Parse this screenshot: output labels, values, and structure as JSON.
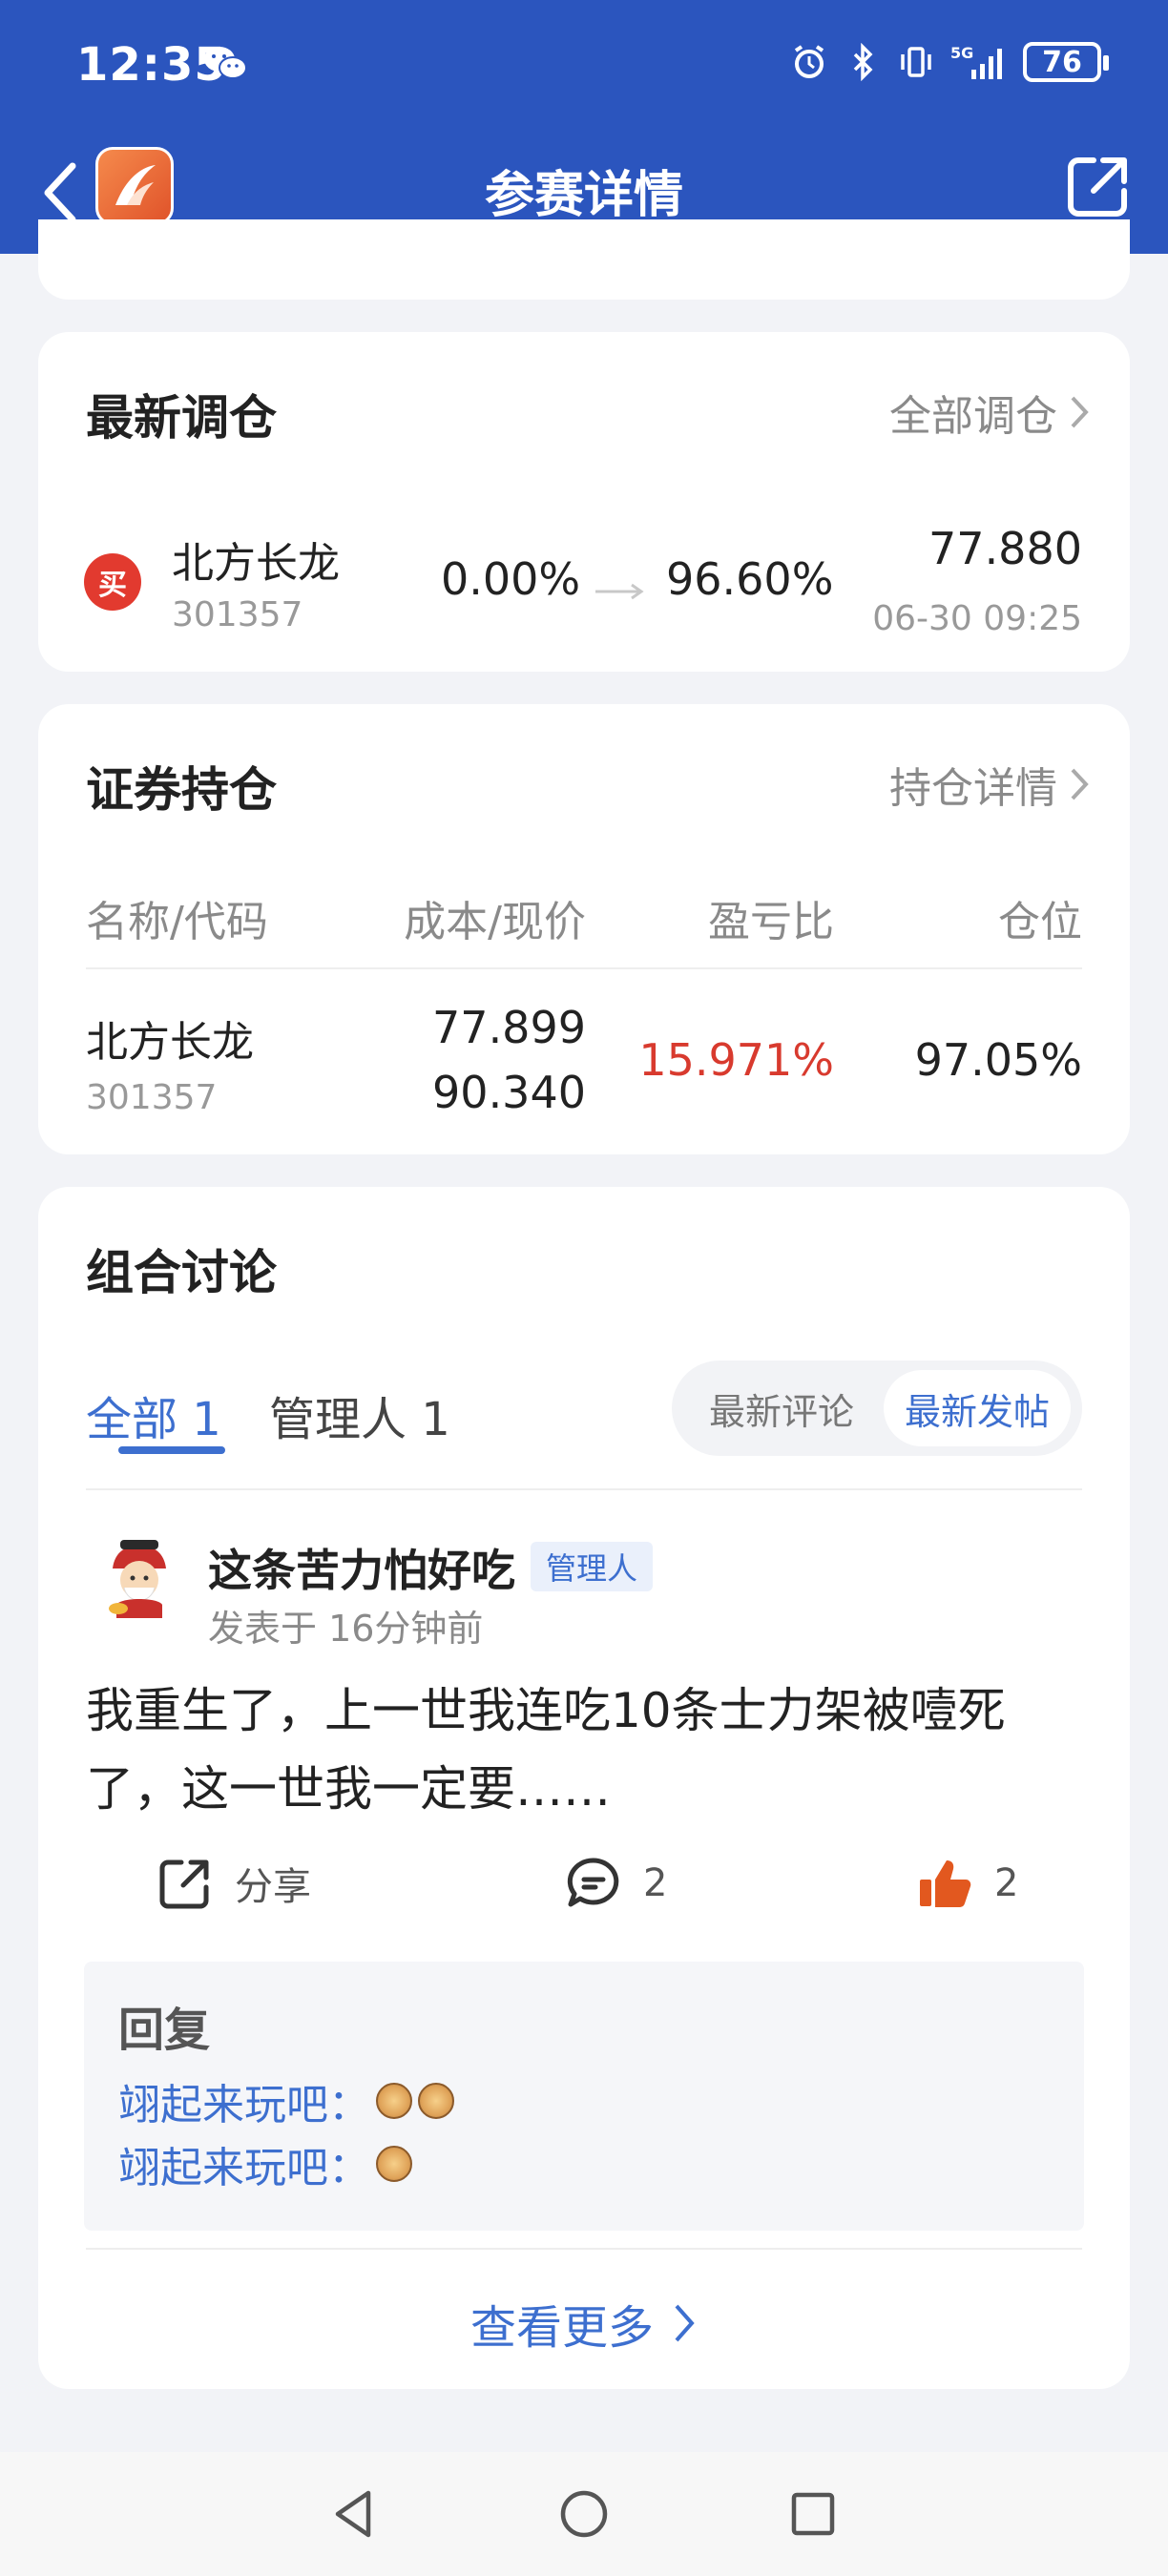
{
  "status_bar": {
    "time": "12:35",
    "battery": "76"
  },
  "nav": {
    "title": "参赛详情"
  },
  "latest_adjust": {
    "title": "最新调仓",
    "link": "全部调仓",
    "badge": "买",
    "stock_name": "北方长龙",
    "stock_code": "301357",
    "from_pct": "0.00%",
    "to_pct": "96.60%",
    "price": "77.880",
    "datetime": "06-30 09:25"
  },
  "holdings": {
    "title": "证券持仓",
    "link": "持仓详情",
    "headers": [
      "名称/代码",
      "成本/现价",
      "盈亏比",
      "仓位"
    ],
    "rows": [
      {
        "name": "北方长龙",
        "code": "301357",
        "cost": "77.899",
        "price": "90.340",
        "pnl": "15.971%",
        "position": "97.05%"
      }
    ]
  },
  "discussion": {
    "title": "组合讨论",
    "tabs": [
      "全部 1",
      "管理人 1"
    ],
    "sort_options": [
      "最新评论",
      "最新发帖"
    ],
    "post": {
      "author": "这条苦力怕好吃",
      "badge": "管理人",
      "time": "发表于 16分钟前",
      "body": "我重生了，上一世我连吃10条士力架被噎死了，这一世我一定要……",
      "share_label": "分享",
      "comment_count": "2",
      "like_count": "2"
    },
    "replies": {
      "title": "回复",
      "items": [
        "翊起来玩吧：",
        "翊起来玩吧："
      ]
    },
    "more_label": "查看更多"
  }
}
